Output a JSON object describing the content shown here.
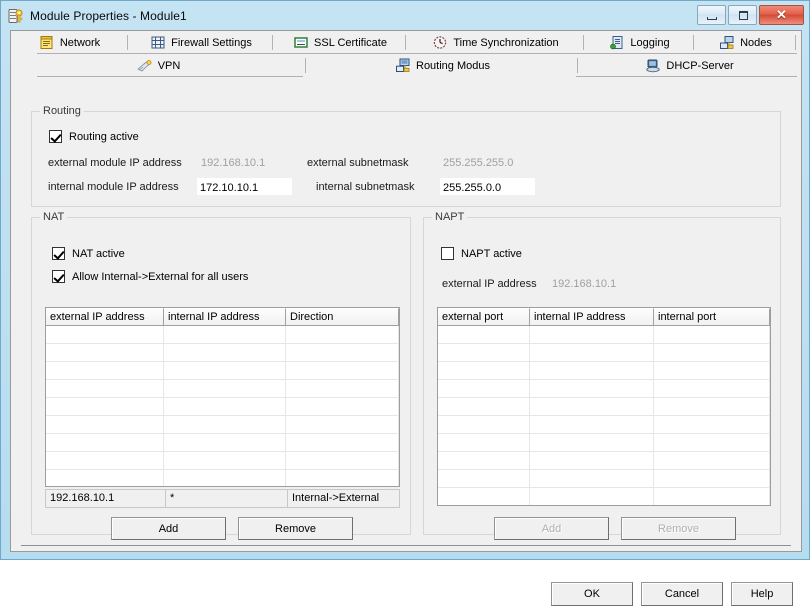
{
  "window": {
    "title": "Module Properties - Module1",
    "icon": "module-key-icon",
    "buttons": {
      "minimize": "minimize-icon",
      "maximize": "maximize-icon",
      "close": "✕"
    }
  },
  "tabs": {
    "row1": [
      {
        "label": "Network",
        "icon": "network-document-icon",
        "active": false
      },
      {
        "label": "Firewall Settings",
        "icon": "firewall-grid-icon",
        "active": false
      },
      {
        "label": "SSL Certificate",
        "icon": "ssl-certificate-icon",
        "active": false
      },
      {
        "label": "Time Synchronization",
        "icon": "clock-icon",
        "active": false
      },
      {
        "label": "Logging",
        "icon": "logbook-icon",
        "active": false
      },
      {
        "label": "Nodes",
        "icon": "nodes-icon",
        "active": false
      }
    ],
    "row2": [
      {
        "label": "VPN",
        "icon": "vpn-key-icon",
        "active": false
      },
      {
        "label": "Routing Modus",
        "icon": "routing-icon",
        "active": true
      },
      {
        "label": "DHCP-Server",
        "icon": "dhcp-server-icon",
        "active": false
      }
    ]
  },
  "routing": {
    "group_title": "Routing",
    "active_checkbox": {
      "label": "Routing active",
      "checked": true
    },
    "fields": {
      "external_ip_label": "external module IP address",
      "external_ip_value": "192.168.10.1",
      "internal_ip_label": "internal module IP address",
      "internal_ip_value": "172.10.10.1",
      "external_mask_label": "external subnetmask",
      "external_mask_value": "255.255.255.0",
      "internal_mask_label": "internal subnetmask",
      "internal_mask_value": "255.255.0.0"
    }
  },
  "nat": {
    "group_title": "NAT",
    "active_checkbox": {
      "label": "NAT active",
      "checked": true
    },
    "allow_checkbox": {
      "label": "Allow Internal->External for all users",
      "checked": true
    },
    "columns": [
      "external IP address",
      "internal IP address",
      "Direction"
    ],
    "rows": [],
    "edit_row": [
      "192.168.10.1",
      "*",
      "Internal->External"
    ],
    "add_button": {
      "label": "Add",
      "enabled": true
    },
    "remove_button": {
      "label": "Remove",
      "enabled": true
    }
  },
  "napt": {
    "group_title": "NAPT",
    "active_checkbox": {
      "label": "NAPT active",
      "checked": false
    },
    "external_ip_label": "external IP address",
    "external_ip_value": "192.168.10.1",
    "columns": [
      "external port",
      "internal IP address",
      "internal port"
    ],
    "rows": [],
    "add_button": {
      "label": "Add",
      "enabled": false
    },
    "remove_button": {
      "label": "Remove",
      "enabled": false
    }
  },
  "footer": {
    "ok": "OK",
    "cancel": "Cancel",
    "help": "Help"
  },
  "colors": {
    "window_frame": "#b6dcf0",
    "client_bg": "#f0f0f0",
    "disabled_text": "#a0a0a0",
    "close_button": "#d44a33"
  }
}
